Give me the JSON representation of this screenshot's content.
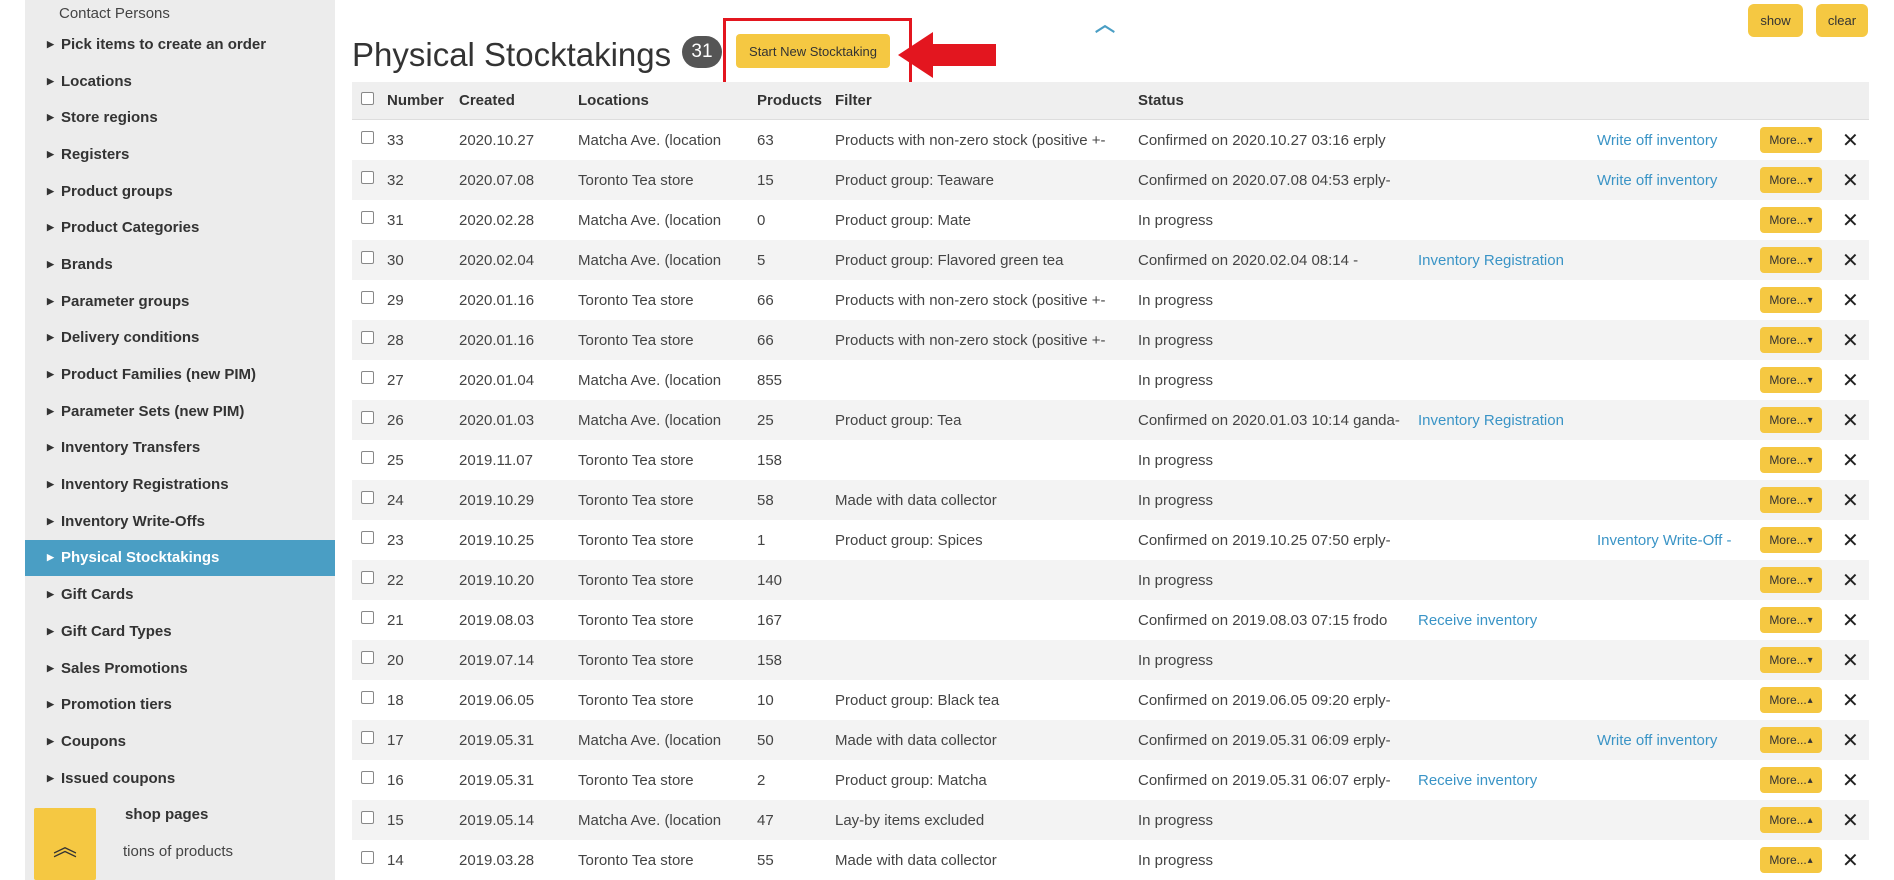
{
  "sidebar": {
    "items": [
      {
        "label": "Contact Persons",
        "plain": true
      },
      {
        "label": "Pick items to create an order"
      },
      {
        "label": "Locations"
      },
      {
        "label": "Store regions"
      },
      {
        "label": "Registers"
      },
      {
        "label": "Product groups"
      },
      {
        "label": "Product Categories"
      },
      {
        "label": "Brands"
      },
      {
        "label": "Parameter groups"
      },
      {
        "label": "Delivery conditions"
      },
      {
        "label": "Product Families (new PIM)"
      },
      {
        "label": "Parameter Sets (new PIM)"
      },
      {
        "label": "Inventory Transfers"
      },
      {
        "label": "Inventory Registrations"
      },
      {
        "label": "Inventory Write-Offs"
      },
      {
        "label": "Physical Stocktakings",
        "active": true
      },
      {
        "label": "Gift Cards"
      },
      {
        "label": "Gift Card Types"
      },
      {
        "label": "Sales Promotions"
      },
      {
        "label": "Promotion tiers"
      },
      {
        "label": "Coupons"
      },
      {
        "label": "Issued coupons"
      },
      {
        "label": "shop pages",
        "partial": true
      },
      {
        "label": "tions of products",
        "plain": true,
        "partial": true
      }
    ]
  },
  "header": {
    "title": "Physical Stocktakings",
    "count": "31",
    "start_button": "Start New Stocktaking",
    "show_button": "show",
    "clear_button": "clear"
  },
  "table": {
    "columns": [
      "Number",
      "Created",
      "Locations",
      "Products",
      "Filter",
      "Status"
    ],
    "more_label": "More...",
    "rows": [
      {
        "number": "33",
        "created": "2020.10.27",
        "location": "Matcha Ave. (location",
        "products": "63",
        "filter": "Products with non-zero stock (positive +-",
        "status": "Confirmed on 2020.10.27 03:16 erply",
        "link1": "",
        "link2": "Write off inventory",
        "more_caret": "▾"
      },
      {
        "number": "32",
        "created": "2020.07.08",
        "location": "Toronto Tea store",
        "products": "15",
        "filter": "Product group: Teaware",
        "status": "Confirmed on 2020.07.08 04:53 erply-",
        "link1": "",
        "link2": "Write off inventory",
        "more_caret": "▾"
      },
      {
        "number": "31",
        "created": "2020.02.28",
        "location": "Matcha Ave. (location",
        "products": "0",
        "filter": "Product group: Mate",
        "status": "In progress",
        "link1": "",
        "link2": "",
        "more_caret": "▾"
      },
      {
        "number": "30",
        "created": "2020.02.04",
        "location": "Matcha Ave. (location",
        "products": "5",
        "filter": "Product group: Flavored green tea",
        "status": "Confirmed on 2020.02.04 08:14 -",
        "link1": "Inventory Registration",
        "link2": "",
        "more_caret": "▾"
      },
      {
        "number": "29",
        "created": "2020.01.16",
        "location": "Toronto Tea store",
        "products": "66",
        "filter": "Products with non-zero stock (positive +-",
        "status": "In progress",
        "link1": "",
        "link2": "",
        "more_caret": "▾"
      },
      {
        "number": "28",
        "created": "2020.01.16",
        "location": "Toronto Tea store",
        "products": "66",
        "filter": "Products with non-zero stock (positive +-",
        "status": "In progress",
        "link1": "",
        "link2": "",
        "more_caret": "▾"
      },
      {
        "number": "27",
        "created": "2020.01.04",
        "location": "Matcha Ave. (location",
        "products": "855",
        "filter": "",
        "status": "In progress",
        "link1": "",
        "link2": "",
        "more_caret": "▾"
      },
      {
        "number": "26",
        "created": "2020.01.03",
        "location": "Matcha Ave. (location",
        "products": "25",
        "filter": "Product group: Tea",
        "status": "Confirmed on 2020.01.03 10:14 ganda-",
        "link1": "Inventory Registration",
        "link2": "",
        "more_caret": "▾"
      },
      {
        "number": "25",
        "created": "2019.11.07",
        "location": "Toronto Tea store",
        "products": "158",
        "filter": "",
        "status": "In progress",
        "link1": "",
        "link2": "",
        "more_caret": "▾"
      },
      {
        "number": "24",
        "created": "2019.10.29",
        "location": "Toronto Tea store",
        "products": "58",
        "filter": "Made with data collector",
        "status": "In progress",
        "link1": "",
        "link2": "",
        "more_caret": "▾"
      },
      {
        "number": "23",
        "created": "2019.10.25",
        "location": "Toronto Tea store",
        "products": "1",
        "filter": "Product group: Spices",
        "status": "Confirmed on 2019.10.25 07:50 erply-",
        "link1": "",
        "link2": "Inventory Write-Off -",
        "more_caret": "▾"
      },
      {
        "number": "22",
        "created": "2019.10.20",
        "location": "Toronto Tea store",
        "products": "140",
        "filter": "",
        "status": "In progress",
        "link1": "",
        "link2": "",
        "more_caret": "▾"
      },
      {
        "number": "21",
        "created": "2019.08.03",
        "location": "Toronto Tea store",
        "products": "167",
        "filter": "",
        "status": "Confirmed on 2019.08.03 07:15 frodo",
        "link1": "Receive inventory",
        "link2": "",
        "more_caret": "▾"
      },
      {
        "number": "20",
        "created": "2019.07.14",
        "location": "Toronto Tea store",
        "products": "158",
        "filter": "",
        "status": "In progress",
        "link1": "",
        "link2": "",
        "more_caret": "▾"
      },
      {
        "number": "18",
        "created": "2019.06.05",
        "location": "Toronto Tea store",
        "products": "10",
        "filter": "Product group: Black tea",
        "status": "Confirmed on 2019.06.05 09:20 erply-",
        "link1": "",
        "link2": "",
        "more_caret": "▴"
      },
      {
        "number": "17",
        "created": "2019.05.31",
        "location": "Matcha Ave. (location",
        "products": "50",
        "filter": "Made with data collector",
        "status": "Confirmed on 2019.05.31 06:09 erply-",
        "link1": "",
        "link2": "Write off inventory",
        "more_caret": "▴"
      },
      {
        "number": "16",
        "created": "2019.05.31",
        "location": "Toronto Tea store",
        "products": "2",
        "filter": "Product group: Matcha",
        "status": "Confirmed on 2019.05.31 06:07 erply-",
        "link1": "Receive inventory",
        "link2": "",
        "more_caret": "▴"
      },
      {
        "number": "15",
        "created": "2019.05.14",
        "location": "Matcha Ave. (location",
        "products": "47",
        "filter": "Lay-by items excluded",
        "status": "In progress",
        "link1": "",
        "link2": "",
        "more_caret": "▴"
      },
      {
        "number": "14",
        "created": "2019.03.28",
        "location": "Toronto Tea store",
        "products": "55",
        "filter": "Made with data collector",
        "status": "In progress",
        "link1": "",
        "link2": "",
        "more_caret": "▴"
      }
    ]
  },
  "colors": {
    "accent": "#f5c842",
    "active": "#4a9ec4",
    "link": "#3a94c6",
    "highlight": "#e3161f"
  }
}
